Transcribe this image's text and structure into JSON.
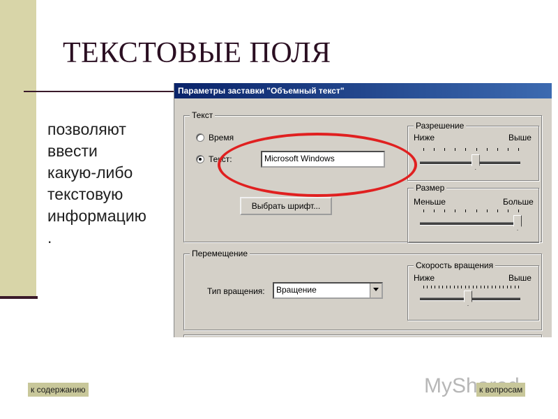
{
  "slide": {
    "title": "ТЕКСТОВЫЕ ПОЛЯ",
    "description_lines": [
      "позволяют",
      "ввести",
      "какую-либо",
      "текстовую",
      "информацию",
      "."
    ]
  },
  "dialog": {
    "title": "Параметры заставки \"Объемный текст\"",
    "text_group": {
      "label": "Текст",
      "option_time": "Время",
      "option_text": "Текст:",
      "text_value": "Microsoft Windows",
      "font_button": "Выбрать шрифт..."
    },
    "resolution_group": {
      "label": "Разрешение",
      "min_label": "Ниже",
      "max_label": "Выше",
      "level": 0.55
    },
    "size_group": {
      "label": "Размер",
      "min_label": "Меньше",
      "max_label": "Больше",
      "level": 1.0
    },
    "movement_group": {
      "label": "Перемещение",
      "rotation_type_label": "Тип вращения:",
      "rotation_type_value": "Вращение"
    },
    "speed_group": {
      "label": "Скорость вращения",
      "min_label": "Ниже",
      "max_label": "Выше",
      "level": 0.47
    }
  },
  "nav": {
    "back_to_contents": "к содержанию",
    "to_questions": "к вопросам"
  },
  "watermark": "MyShared",
  "colors": {
    "left_bar": "#d8d5a8",
    "accent_dark": "#3a1a2a",
    "highlight": "#e02020",
    "nav_button": "#c8c79a",
    "titlebar": "#0a246a"
  }
}
